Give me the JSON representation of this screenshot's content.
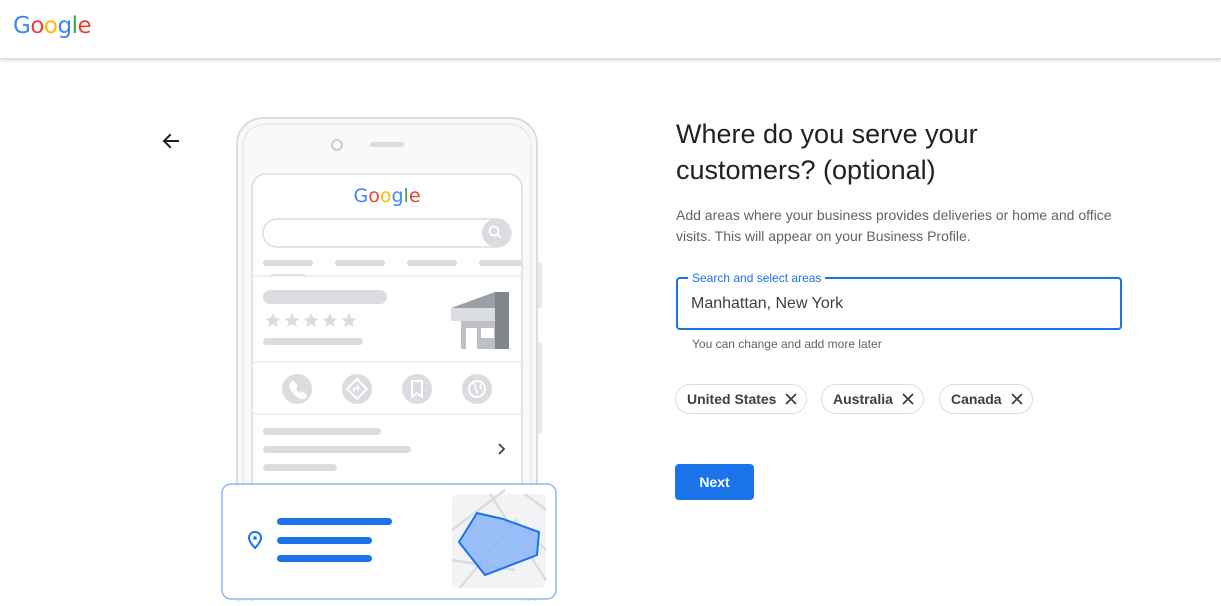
{
  "header": {
    "logo_letters": [
      {
        "char": "G",
        "color": "#4285F4"
      },
      {
        "char": "o",
        "color": "#EA4335"
      },
      {
        "char": "o",
        "color": "#FBBC05"
      },
      {
        "char": "g",
        "color": "#4285F4"
      },
      {
        "char": "l",
        "color": "#34A853"
      },
      {
        "char": "e",
        "color": "#EA4335"
      }
    ]
  },
  "nav": {
    "back_icon": "arrow-back-icon"
  },
  "illustration": {
    "phone_logo_letters": [
      {
        "char": "G",
        "color": "#4285F4"
      },
      {
        "char": "o",
        "color": "#EA4335"
      },
      {
        "char": "o",
        "color": "#FBBC05"
      },
      {
        "char": "g",
        "color": "#4285F4"
      },
      {
        "char": "l",
        "color": "#34A853"
      },
      {
        "char": "e",
        "color": "#EA4335"
      }
    ],
    "icons": [
      "search-icon",
      "phone-icon",
      "directions-icon",
      "bookmark-icon",
      "globe-icon",
      "chevron-right-icon",
      "location-pin-icon",
      "store-icon"
    ]
  },
  "main": {
    "title": "Where do you serve your customers? (optional)",
    "description": "Add areas where your business provides deliveries or home and office visits. This will appear on your Business Profile.",
    "search_field": {
      "label": "Search and select areas",
      "value": "Manhattan, New York"
    },
    "helper_text": "You can change and add more later",
    "chips": [
      {
        "label": "United States"
      },
      {
        "label": "Australia"
      },
      {
        "label": "Canada"
      }
    ],
    "next_label": "Next"
  },
  "colors": {
    "accent": "#1a73e8",
    "text_primary": "#202124",
    "text_secondary": "#5f6368",
    "chip_border": "#dadce0"
  }
}
